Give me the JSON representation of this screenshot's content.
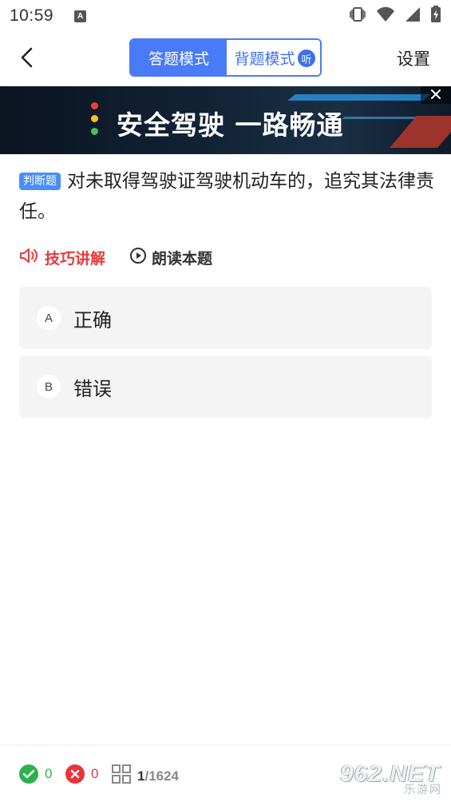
{
  "status_bar": {
    "time": "10:59",
    "notification_icon": "A",
    "icons": [
      "vibrate-icon",
      "wifi-icon",
      "signal-icon",
      "battery-icon"
    ]
  },
  "header": {
    "back_icon": "chevron-left-icon",
    "mode_tabs": [
      {
        "label": "答题模式",
        "active": true
      },
      {
        "label": "背题模式",
        "active": false,
        "badge": "听"
      }
    ],
    "settings_label": "设置"
  },
  "banner": {
    "text": "安全驾驶 一路畅通",
    "close_icon": "close-icon",
    "light_colors": [
      "#e8413a",
      "#f4c21c",
      "#43c05c"
    ]
  },
  "question": {
    "type_tag": "判断题",
    "text": "对未取得驾驶证驾驶机动车的，追究其法律责任。"
  },
  "tools": {
    "skill_label": "技巧讲解",
    "read_label": "朗读本题"
  },
  "options": [
    {
      "letter": "A",
      "text": "正确"
    },
    {
      "letter": "B",
      "text": "错误"
    }
  ],
  "bottom_bar": {
    "correct_count": "0",
    "wrong_count": "0",
    "progress_current": "1",
    "progress_total": "/1624"
  },
  "watermark": {
    "big": "962.NET",
    "small": "乐游网"
  },
  "colors": {
    "accent": "#4a7bf7",
    "correct": "#2bb24c",
    "wrong": "#e8353a",
    "skill": "#e43b3b"
  }
}
